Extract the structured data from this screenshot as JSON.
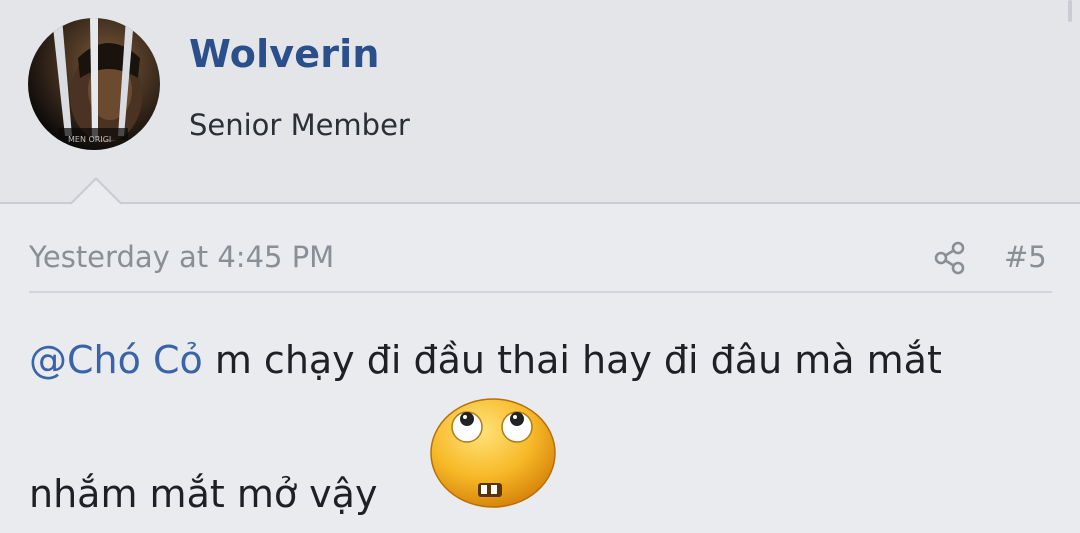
{
  "user": {
    "name": "Wolverin",
    "title": "Senior Member",
    "avatar_icon": "avatar-wolverine"
  },
  "post": {
    "timestamp": "Yesterday at 4:45 PM",
    "share_icon": "share-icon",
    "number": "#5",
    "mention": "@Chó Cỏ",
    "text_line1": "m chạy đi đầu thai hay đi đâu mà mắt",
    "text_line2": "nhắm mắt mở vậy",
    "emoji_icon": "rolling-eyes-emoji"
  },
  "colors": {
    "username": "#2b4f8a",
    "mention": "#3a64a8",
    "meta_text": "#8a8e95",
    "background": "#e9ebee"
  }
}
